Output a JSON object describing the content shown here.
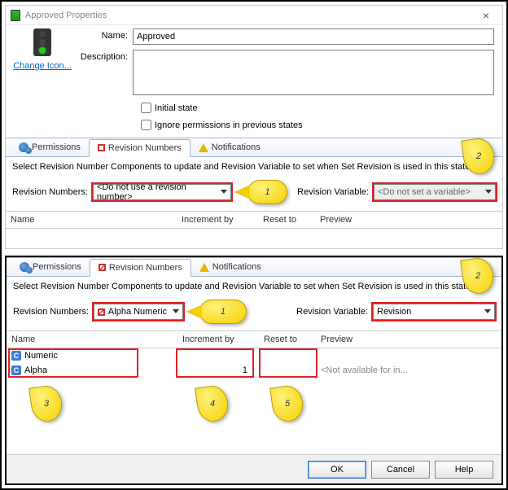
{
  "dialog": {
    "title": "Approved Properties",
    "name_label": "Name:",
    "name_value": "Approved",
    "desc_label": "Description:",
    "desc_value": "",
    "change_icon": "Change Icon...",
    "chk_initial": "Initial state",
    "chk_ignore": "Ignore permissions in previous states"
  },
  "tabs": {
    "permissions": "Permissions",
    "revision": "Revision Numbers",
    "notifications": "Notifications"
  },
  "strip": "Select Revision Number Components to update and Revision Variable to set when Set Revision is used in this state.",
  "top": {
    "rev_label": "Revision Numbers:",
    "rev_value": "<Do not use a revision number>",
    "var_label": "Revision Variable:",
    "var_value": "<Do not set a variable>"
  },
  "cols": {
    "name": "Name",
    "inc": "Increment by",
    "reset": "Reset to",
    "prev": "Preview"
  },
  "bottom": {
    "rev_value": "Alpha Numeric",
    "var_value": "Revision",
    "rows": [
      {
        "name": "Numeric",
        "inc": "",
        "reset": "",
        "preview": ""
      },
      {
        "name": "Alpha",
        "inc": "1",
        "reset": "",
        "preview": "<Not available for in..."
      }
    ]
  },
  "buttons": {
    "ok": "OK",
    "cancel": "Cancel",
    "help": "Help"
  },
  "callouts": {
    "c1": "1",
    "c2": "2",
    "c3": "3",
    "c4": "4",
    "c5": "5"
  }
}
